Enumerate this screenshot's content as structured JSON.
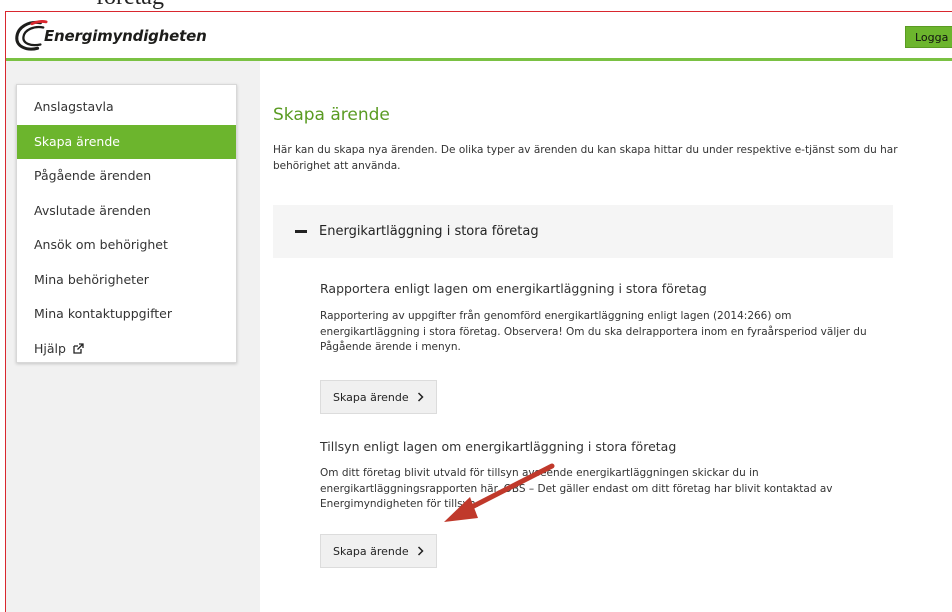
{
  "stray_text": "företag",
  "header": {
    "logo_text": "Energimyndigheten",
    "logout_label": "Logga ut",
    "brand_color": "#6cb52d"
  },
  "sidebar": {
    "items": [
      {
        "label": "Anslagstavla",
        "active": false
      },
      {
        "label": "Skapa ärende",
        "active": true
      },
      {
        "label": "Pågående ärenden",
        "active": false
      },
      {
        "label": "Avslutade ärenden",
        "active": false
      },
      {
        "label": "Ansök om behörighet",
        "active": false
      },
      {
        "label": "Mina behörigheter",
        "active": false
      },
      {
        "label": "Mina kontaktuppgifter",
        "active": false
      },
      {
        "label": "Hjälp",
        "active": false,
        "icon": "external-link-icon"
      }
    ]
  },
  "main": {
    "title": "Skapa ärende",
    "intro": "Här kan du skapa nya ärenden. De olika typer av ärenden du kan skapa hittar du under respektive e-tjänst som du har behörighet att använda.",
    "accordion": {
      "title": "Energikartläggning i stora företag",
      "icon": "minus-icon",
      "sections": [
        {
          "title": "Rapportera enligt lagen om energikartläggning i stora företag",
          "description": "Rapportering av uppgifter från genomförd energikartläggning enligt lagen (2014:266) om energikartläggning i stora företag. Observera! Om du ska delrapportera inom en fyraårsperiod väljer du Pågående ärende i menyn.",
          "button_label": "Skapa ärende"
        },
        {
          "title": "Tillsyn enligt lagen om energikartläggning i stora företag",
          "description": "Om ditt företag blivit utvald för tillsyn avseende energikartläggningen skickar du in energikartläggningsrapporten här. OBS – Det gäller endast om ditt företag har blivit kontaktad av Energimyndigheten för tillsyn.",
          "button_label": "Skapa ärende"
        }
      ]
    }
  },
  "annotation": {
    "arrow_color": "#c0392b"
  }
}
